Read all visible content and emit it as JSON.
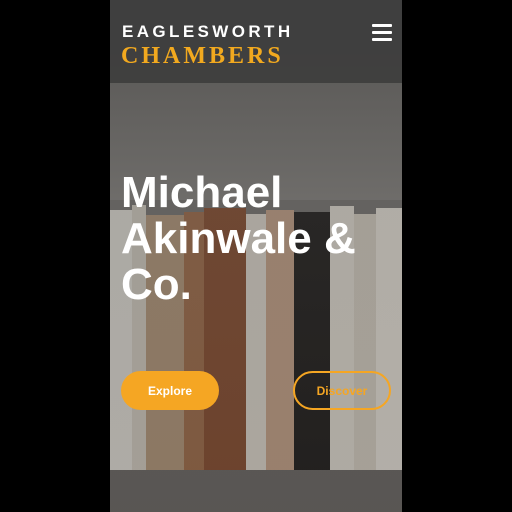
{
  "brand": {
    "line1": "EAGLESWORTH",
    "line2": "CHAMBERS",
    "accent_color": "#f5a623"
  },
  "header": {
    "menu_icon": "hamburger-menu-icon"
  },
  "hero": {
    "title": "Michael Akinwale & Co.",
    "background": "bookshelf-photo"
  },
  "actions": {
    "explore_label": "Explore",
    "discover_label": "Discover"
  }
}
